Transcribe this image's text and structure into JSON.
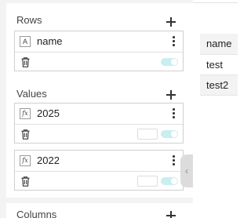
{
  "sections": {
    "rows": {
      "title": "Rows",
      "fields": [
        {
          "type_icon": "text-type-icon",
          "type_glyph": "A",
          "name": "name"
        }
      ]
    },
    "values": {
      "title": "Values",
      "fields": [
        {
          "type_icon": "formula-icon",
          "type_glyph": "fx",
          "name": "2025"
        },
        {
          "type_icon": "formula-icon",
          "type_glyph": "fx",
          "name": "2022"
        }
      ]
    },
    "columns": {
      "title": "Columns"
    }
  },
  "collapse_glyph": "‹",
  "table": {
    "header": "name",
    "rows": [
      "test",
      "test2"
    ]
  },
  "colors": {
    "toggle_on": "#c9eef0",
    "panel_bg": "#f3f3f3"
  }
}
